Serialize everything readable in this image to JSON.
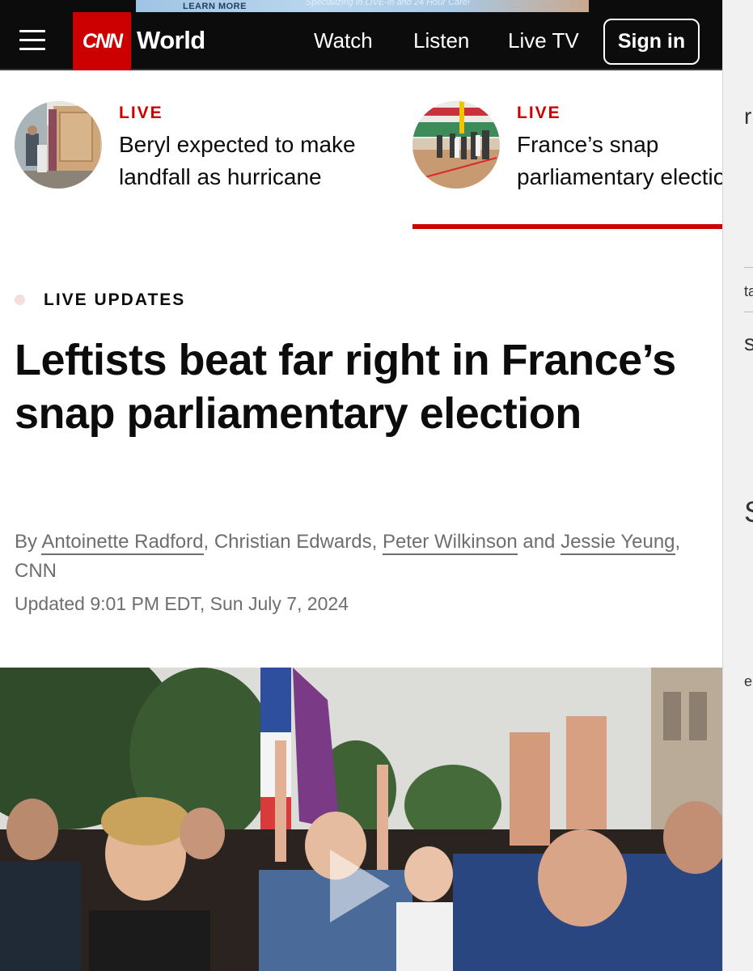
{
  "ad": {
    "learn_more": "LEARN MORE",
    "text": "Specializing in LIVE-in and 24 Hour Care!"
  },
  "header": {
    "logo": "CNN",
    "section": "World",
    "nav": {
      "watch": "Watch",
      "listen": "Listen",
      "live_tv": "Live TV"
    },
    "sign_in": "Sign in",
    "brand_color": "#cc0000"
  },
  "live_cards": [
    {
      "label": "LIVE",
      "title": "Beryl expected to make landfall as hurricane",
      "thumbnail": "boarded-up-storefront-photo"
    },
    {
      "label": "LIVE",
      "title": "France’s snap parliamentary election",
      "thumbnail": "polling-station-photo",
      "active": true
    }
  ],
  "article": {
    "kicker": "LIVE UPDATES",
    "headline": "Leftists beat far right in France’s snap parliamentary election",
    "byline": {
      "prefix": "By",
      "authors": [
        "Antoinette Radford",
        "Christian Edwards",
        "Peter Wilkinson",
        "Jessie Yeung"
      ],
      "sep1": ",",
      "sep2": ",",
      "conj": "and",
      "suffix": ", CNN"
    },
    "updated": "Updated 9:01 PM EDT, Sun July 7, 2024",
    "hero_image": "crowd-celebrating-with-french-flag-photo",
    "video_play_icon": "play-icon"
  },
  "right_sliver": {
    "fragments": [
      "r",
      "ta",
      "s/",
      "S",
      "e"
    ]
  }
}
